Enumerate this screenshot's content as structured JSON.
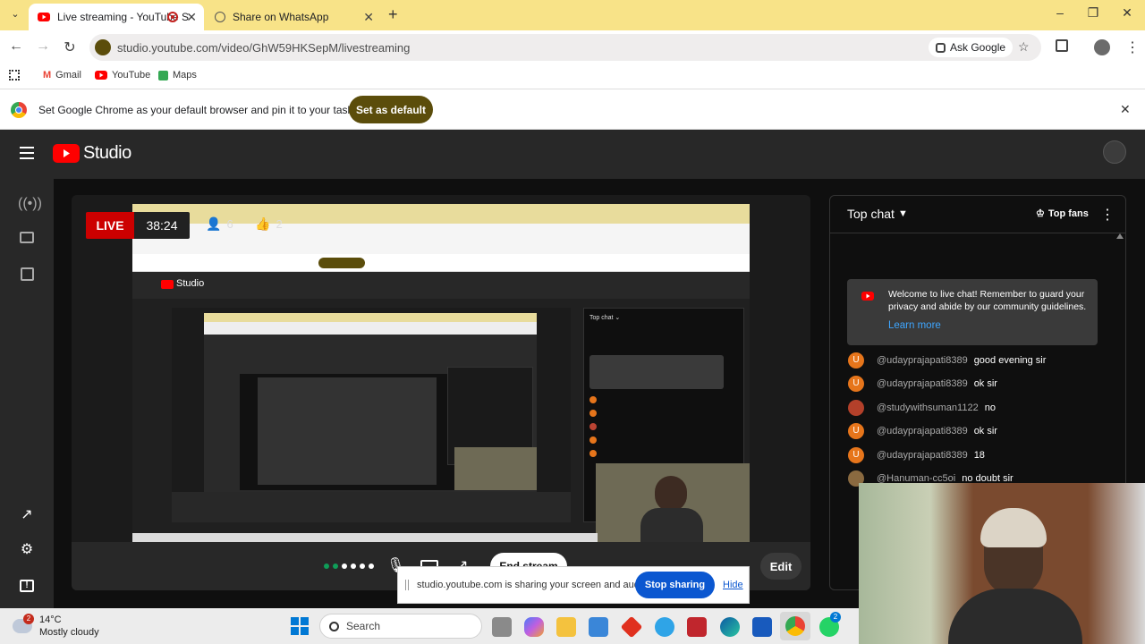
{
  "browser": {
    "tabs": [
      {
        "title": "Live streaming - YouTube S",
        "active": true
      },
      {
        "title": "Share on WhatsApp",
        "active": false
      }
    ],
    "url": "studio.youtube.com/video/GhW59HKSepM/livestreaming",
    "ask_google": "Ask Google",
    "bookmarks": [
      "Gmail",
      "YouTube",
      "Maps"
    ],
    "infobar_text": "Set Google Chrome as your default browser and pin it to your taskbar",
    "set_default_label": "Set as default"
  },
  "studio": {
    "logo_text": "Studio",
    "live_badge": "LIVE",
    "elapsed": "38:24",
    "viewers": "6",
    "likes": "2",
    "edit_label": "Edit",
    "end_stream_label": "End stream"
  },
  "chat": {
    "mode_label": "Top chat",
    "top_fans_label": "Top fans",
    "welcome_text": "Welcome to live chat! Remember to guard your privacy and abide by our community guidelines.",
    "learn_more": "Learn more",
    "messages": [
      {
        "avatar": "U",
        "user": "@udayprajapati8389",
        "text": "good evening sir"
      },
      {
        "avatar": "U",
        "user": "@udayprajapati8389",
        "text": "ok sir"
      },
      {
        "avatar": "",
        "user": "@studywithsuman1122",
        "text": "no"
      },
      {
        "avatar": "U",
        "user": "@udayprajapati8389",
        "text": "ok sir"
      },
      {
        "avatar": "U",
        "user": "@udayprajapati8389",
        "text": "18"
      },
      {
        "avatar": "",
        "user": "@Hanuman-cc5oi",
        "text": "no doubt sir"
      }
    ]
  },
  "share_bar": {
    "text": "studio.youtube.com is sharing your screen and audio.",
    "stop_label": "Stop sharing",
    "hide_label": "Hide"
  },
  "taskbar": {
    "weather_temp": "14°C",
    "weather_desc": "Mostly cloudy",
    "weather_badge": "2",
    "search_label": "Search",
    "whatsapp_badge": "2"
  },
  "colors": {
    "chrome_frame": "#f8e388",
    "live_red": "#cc0000",
    "yt_red": "#ff0000",
    "studio_bg": "#282828",
    "accent_blue": "#3ea6ff"
  }
}
